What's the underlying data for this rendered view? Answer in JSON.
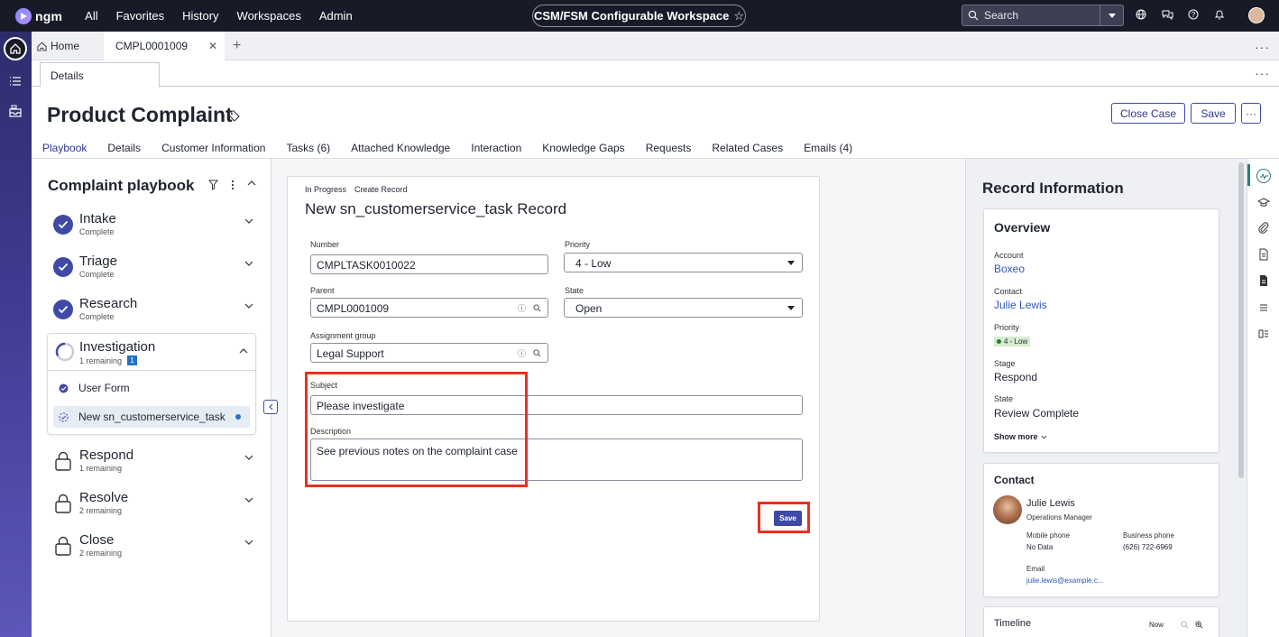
{
  "topnav": {
    "logo": "ngm",
    "items": [
      "All",
      "Favorites",
      "History",
      "Workspaces",
      "Admin"
    ],
    "workspace": "CSM/FSM Configurable Workspace",
    "search_placeholder": "Search"
  },
  "tabs": {
    "home": "Home",
    "record": "CMPL0001009"
  },
  "subtab": "Details",
  "header": {
    "title": "Product Complaint",
    "close_case": "Close Case",
    "save": "Save",
    "more": "···"
  },
  "main_tabs": [
    "Playbook",
    "Details",
    "Customer Information",
    "Tasks (6)",
    "Attached Knowledge",
    "Interaction",
    "Knowledge Gaps",
    "Requests",
    "Related Cases",
    "Emails (4)"
  ],
  "playbook": {
    "title": "Complaint playbook",
    "stages": [
      {
        "name": "Intake",
        "status": "Complete"
      },
      {
        "name": "Triage",
        "status": "Complete"
      },
      {
        "name": "Research",
        "status": "Complete"
      },
      {
        "name": "Investigation",
        "status": "1 remaining",
        "badge": "1"
      },
      {
        "name": "Respond",
        "status": "1 remaining"
      },
      {
        "name": "Resolve",
        "status": "2 remaining"
      },
      {
        "name": "Close",
        "status": "2 remaining"
      }
    ],
    "tasks": [
      "User Form",
      "New sn_customerservice_task"
    ]
  },
  "form": {
    "crumb_state": "In Progress",
    "crumb_action": "Create Record",
    "title": "New sn_customerservice_task Record",
    "number_label": "Number",
    "number": "CMPLTASK0010022",
    "priority_label": "Priority",
    "priority": "4 - Low",
    "parent_label": "Parent",
    "parent": "CMPL0001009",
    "state_label": "State",
    "state": "Open",
    "group_label": "Assignment group",
    "group": "Legal Support",
    "subject_label": "Subject",
    "subject": "Please investigate",
    "description_label": "Description",
    "description": "See previous notes on the complaint case",
    "save": "Save"
  },
  "record_info": {
    "title": "Record Information",
    "overview_title": "Overview",
    "account_label": "Account",
    "account": "Boxeo",
    "contact_label": "Contact",
    "contact": "Julie Lewis",
    "priority_label": "Priority",
    "priority": "4 - Low",
    "stage_label": "Stage",
    "stage": "Respond",
    "state_label": "State",
    "state": "Review Complete",
    "show_more": "Show more",
    "contact_card_title": "Contact",
    "contact_name": "Julie Lewis",
    "contact_role": "Operations Manager",
    "mobile_label": "Mobile phone",
    "mobile": "No Data",
    "business_label": "Business phone",
    "business": "(626) 722-6969",
    "email_label": "Email",
    "email": "julie.lewis@example.c...",
    "timeline_title": "Timeline",
    "timeline_now": "Now"
  },
  "colors": {
    "accent": "#3f4aa6",
    "highlight": "#ee2f1f",
    "nav": "#181a27"
  }
}
